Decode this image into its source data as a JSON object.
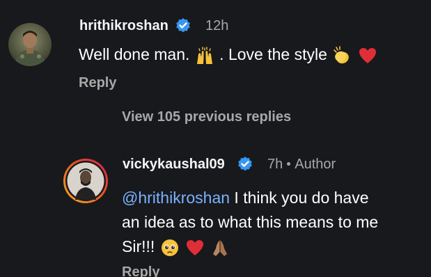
{
  "comments": [
    {
      "username": "hrithikroshan",
      "verified": true,
      "time": "12h",
      "text_parts": [
        "Well done man.",
        ". Love the style"
      ],
      "emojis": [
        "raising-hands-emoji",
        "clapping-hands-emoji",
        "red-heart-emoji"
      ],
      "reply_label": "Reply"
    },
    {
      "username": "vickykaushal09",
      "verified": true,
      "time": "7h",
      "role": "Author",
      "mention": "@hrithikroshan",
      "text_line1_rest": "I think you do have",
      "text_line2": "an idea as to what this means to me",
      "text_line3": "Sir!!!",
      "emojis": [
        "pleading-face-emoji",
        "red-heart-emoji",
        "folded-hands-emoji"
      ],
      "reply_label": "Reply"
    }
  ],
  "view_previous_label": "View 105 previous replies",
  "colors": {
    "background": "#18191d",
    "text": "#ffffff",
    "muted": "#a8a8a8",
    "mention": "#7bb2ff",
    "verified": "#3897f0",
    "story_ring_start": "#f9a825",
    "story_ring_end": "#d81b60"
  }
}
